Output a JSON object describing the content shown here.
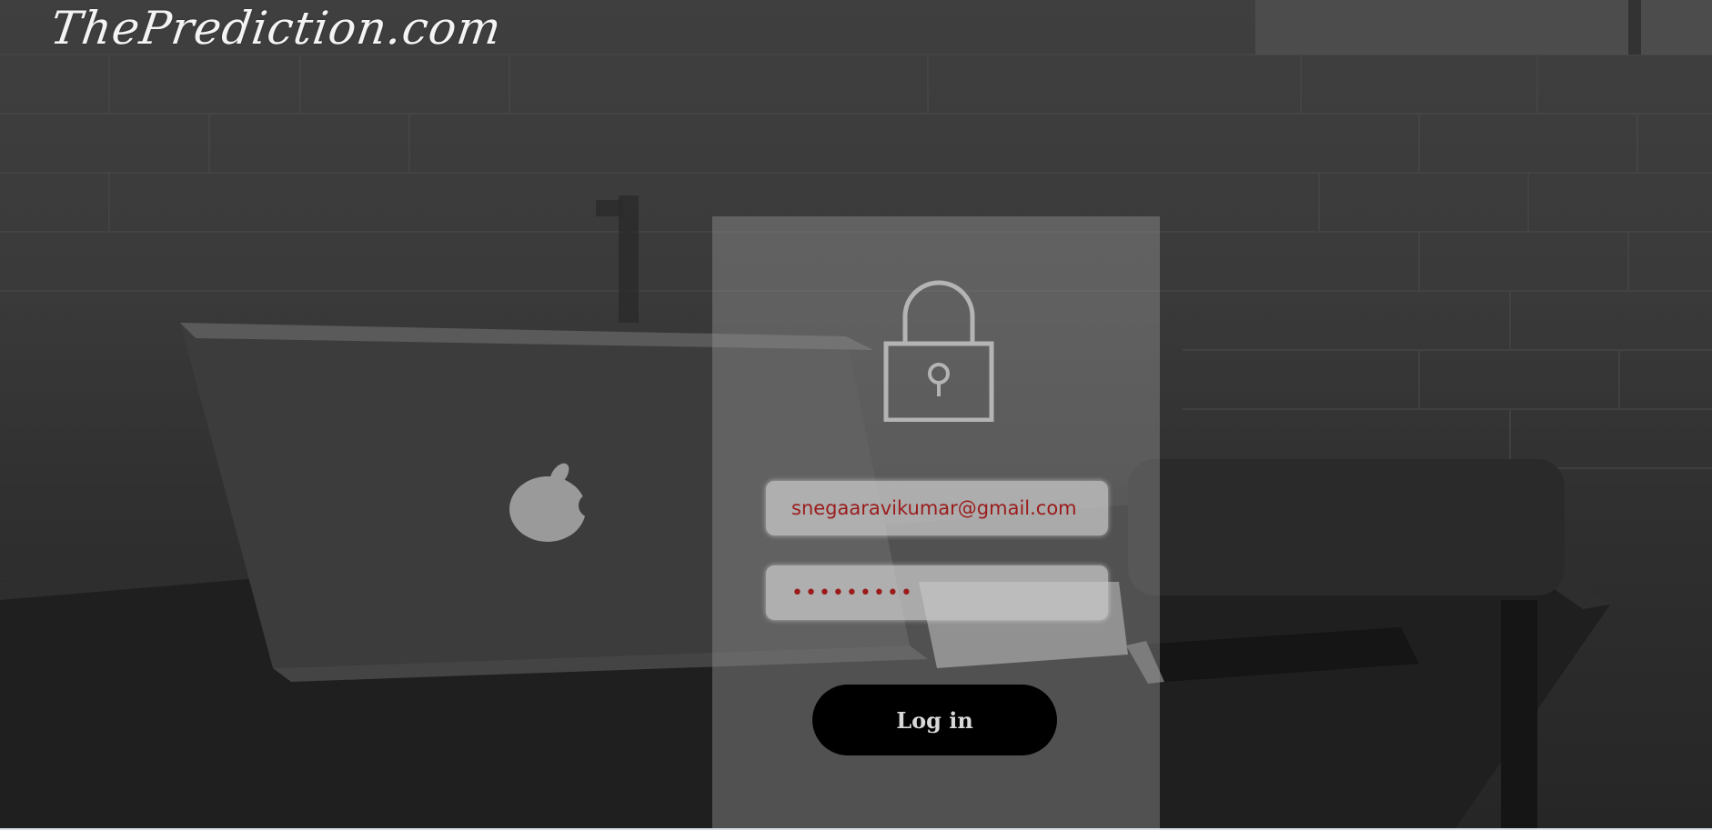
{
  "brand": {
    "title": "ThePrediction.com"
  },
  "login": {
    "email_value": "snegaaravikumar@gmail.com",
    "password_value": "•••••••••",
    "submit_label": "Log in",
    "lock_icon": "padlock-icon"
  },
  "colors": {
    "input_text": "#9b1b1b",
    "button_bg": "#000000",
    "button_text": "#d8d8d8",
    "brand_text": "#f4f4f4"
  }
}
